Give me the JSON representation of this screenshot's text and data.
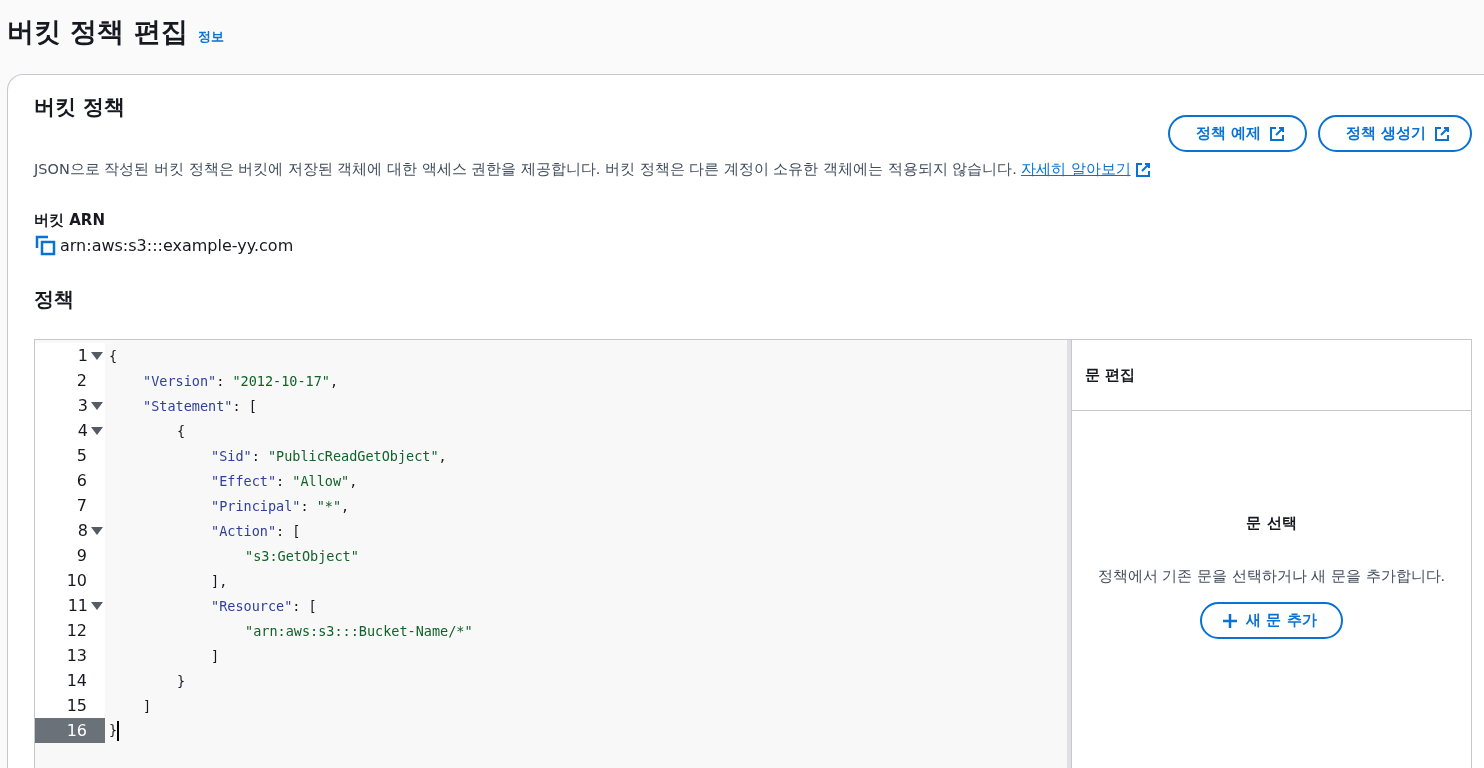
{
  "page": {
    "title": "버킷 정책 편집",
    "info_link": "정보"
  },
  "policy_card": {
    "title": "버킷 정책",
    "description": "JSON으로 작성된 버킷 정책은 버킷에 저장된 객체에 대한 액세스 권한을 제공합니다. 버킷 정책은 다른 계정이 소유한 객체에는 적용되지 않습니다.",
    "learn_more": "자세히 알아보기",
    "buttons": [
      "정책 예제",
      "정책 생성기"
    ],
    "arn_label": "버킷 ARN",
    "arn": "arn:aws:s3:::example-yy.com",
    "policy_label": "정책"
  },
  "editor": {
    "lines": [
      {
        "number": "1",
        "foldable": true,
        "active": false,
        "tokens": [
          {
            "kind": "open",
            "text": "{"
          }
        ]
      },
      {
        "number": "2",
        "foldable": false,
        "active": false,
        "tokens": [
          {
            "kind": "key",
            "text": "\"Version\""
          },
          {
            "kind": "punct",
            "text": ": "
          },
          {
            "kind": "string",
            "text": "\"2012-10-17\""
          },
          {
            "kind": "punct",
            "text": ","
          }
        ]
      },
      {
        "number": "3",
        "foldable": true,
        "active": false,
        "tokens": [
          {
            "kind": "key",
            "text": "\"Statement\""
          },
          {
            "kind": "punct",
            "text": ": "
          },
          {
            "kind": "open",
            "text": "["
          }
        ]
      },
      {
        "number": "4",
        "foldable": true,
        "active": false,
        "tokens": [
          {
            "kind": "open",
            "text": "{"
          }
        ]
      },
      {
        "number": "5",
        "foldable": false,
        "active": false,
        "tokens": [
          {
            "kind": "key",
            "text": "\"Sid\""
          },
          {
            "kind": "punct",
            "text": ": "
          },
          {
            "kind": "string",
            "text": "\"PublicReadGetObject\""
          },
          {
            "kind": "punct",
            "text": ","
          }
        ]
      },
      {
        "number": "6",
        "foldable": false,
        "active": false,
        "tokens": [
          {
            "kind": "key",
            "text": "\"Effect\""
          },
          {
            "kind": "punct",
            "text": ": "
          },
          {
            "kind": "string",
            "text": "\"Allow\""
          },
          {
            "kind": "punct",
            "text": ","
          }
        ]
      },
      {
        "number": "7",
        "foldable": false,
        "active": false,
        "tokens": [
          {
            "kind": "key",
            "text": "\"Principal\""
          },
          {
            "kind": "punct",
            "text": ": "
          },
          {
            "kind": "string",
            "text": "\"*\""
          },
          {
            "kind": "punct",
            "text": ","
          }
        ]
      },
      {
        "number": "8",
        "foldable": true,
        "active": false,
        "tokens": [
          {
            "kind": "key",
            "text": "\"Action\""
          },
          {
            "kind": "punct",
            "text": ": "
          },
          {
            "kind": "open",
            "text": "["
          }
        ]
      },
      {
        "number": "9",
        "foldable": false,
        "active": false,
        "tokens": [
          {
            "kind": "string",
            "text": "\"s3:GetObject\""
          }
        ]
      },
      {
        "number": "10",
        "foldable": false,
        "active": false,
        "tokens": [
          {
            "kind": "close",
            "text": "]"
          },
          {
            "kind": "punct",
            "text": ","
          }
        ]
      },
      {
        "number": "11",
        "foldable": true,
        "active": false,
        "tokens": [
          {
            "kind": "key",
            "text": "\"Resource\""
          },
          {
            "kind": "punct",
            "text": ": "
          },
          {
            "kind": "open",
            "text": "["
          }
        ]
      },
      {
        "number": "12",
        "foldable": false,
        "active": false,
        "tokens": [
          {
            "kind": "string",
            "text": "\"arn:aws:s3:::Bucket-Name/*\""
          }
        ]
      },
      {
        "number": "13",
        "foldable": false,
        "active": false,
        "tokens": [
          {
            "kind": "close",
            "text": "]"
          }
        ]
      },
      {
        "number": "14",
        "foldable": false,
        "active": false,
        "tokens": [
          {
            "kind": "close",
            "text": "}"
          }
        ]
      },
      {
        "number": "15",
        "foldable": false,
        "active": false,
        "tokens": [
          {
            "kind": "close",
            "text": "]"
          }
        ]
      },
      {
        "number": "16",
        "foldable": false,
        "active": true,
        "tokens": [
          {
            "kind": "close",
            "text": "}"
          }
        ]
      }
    ]
  },
  "statement_panel": {
    "title": "문 편집",
    "empty_title": "문 선택",
    "empty_text": "정책에서 기존 문을 선택하거나 새 문을 추가합니다.",
    "add_button": "새 문 추가"
  }
}
